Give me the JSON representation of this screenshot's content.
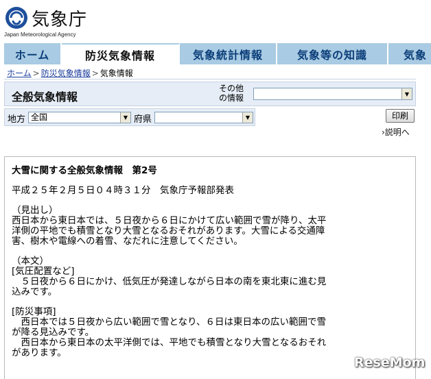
{
  "header": {
    "logo_text": "気象庁",
    "logo_sub": "Japan Meteorological Agency"
  },
  "tabs": [
    {
      "label": "ホーム"
    },
    {
      "label": "防災気象情報"
    },
    {
      "label": "気象統計情報"
    },
    {
      "label": "気象等の知識"
    },
    {
      "label": "気象"
    }
  ],
  "breadcrumb": {
    "home": "ホーム",
    "sep": ">",
    "section": "防災気象情報",
    "current": "気象情報"
  },
  "page": {
    "title": "全般気象情報",
    "other_label": "その他\nの情報"
  },
  "filters": {
    "region_label": "地方",
    "region_value": "全国",
    "pref_label": "府県",
    "pref_value": ""
  },
  "actions": {
    "print": "印刷",
    "help": "›説明へ"
  },
  "content": {
    "title": "大雪に関する全般気象情報　第2号",
    "issued": "平成２５年２月５日０４時３１分　気象庁予報部発表",
    "heading_section": "（見出し）\n西日本から東日本では、５日夜から６日にかけて広い範囲で雪が降り、太平\n洋側の平地でも積雪となり大雪となるおそれがあります。大雪による交通障\n害、樹木や電線への着雪、なだれに注意してください。",
    "body_section": "（本文）\n[気圧配置など]\n　５日夜から６日にかけ、低気圧が発達しながら日本の南を東北東に進む見\n込みです。",
    "disaster_section": "[防災事項]\n　西日本では５日夜から広い範囲で雪となり、６日は東日本の広い範囲で雪\nが降る見込みです。\n　西日本から東日本の太平洋側では、平地でも積雪となり大雪となるおそれ\nがあります。"
  },
  "watermark": "ReseMom",
  "colors": {
    "tab_bg": "#a9cbe3",
    "tab_text": "#0b3e79",
    "title_bar_bg": "#e6edf6",
    "link": "#1a3c9c"
  }
}
